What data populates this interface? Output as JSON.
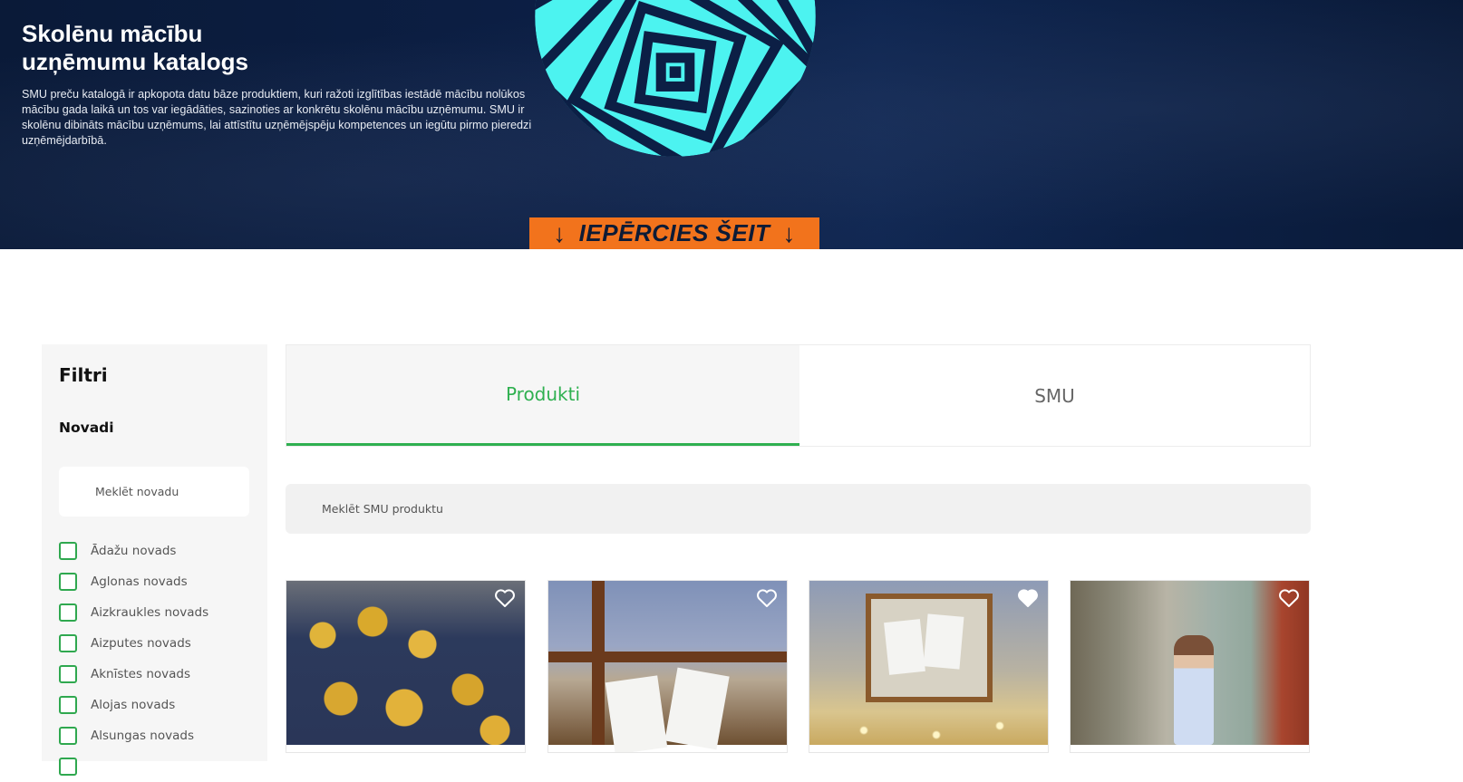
{
  "hero": {
    "title": "Skolēnu mācību uzņēmumu katalogs",
    "description": "SMU preču katalogā ir apkopota datu bāze produktiem, kuri ražoti izglītības iestādē mācību nolūkos mācību gada laikā un tos var iegādāties, sazinoties ar konkrētu skolēnu mācību uzņēmumu. SMU ir skolēnu dibināts mācību uzņēmums, lai attīstītu uzņēmējspēju kompetences un iegūtu pirmo pieredzi uzņēmējdarbībā.",
    "shop_button": "IEPĒRCIES ŠEIT",
    "accent_color": "#f2731c",
    "logo_color": "#4cf3f0"
  },
  "sidebar": {
    "title": "Filtri",
    "section_title": "Novadi",
    "search_placeholder": "Meklēt novadu",
    "items": [
      {
        "label": "Ādažu novads",
        "checked": false
      },
      {
        "label": "Aglonas novads",
        "checked": false
      },
      {
        "label": "Aizkraukles novads",
        "checked": false
      },
      {
        "label": "Aizputes novads",
        "checked": false
      },
      {
        "label": "Aknīstes novads",
        "checked": false
      },
      {
        "label": "Alojas novads",
        "checked": false
      },
      {
        "label": "Alsungas novads",
        "checked": false
      }
    ]
  },
  "tabs": [
    {
      "label": "Produkti",
      "active": true
    },
    {
      "label": "SMU",
      "active": false
    }
  ],
  "product_search": {
    "placeholder": "Meklēt SMU produktu"
  },
  "products": [
    {
      "image": "beeswax-candles",
      "favorited": false
    },
    {
      "image": "framed-line-drawings",
      "favorited": false
    },
    {
      "image": "framed-drawings-with-lights",
      "favorited": true
    },
    {
      "image": "person-in-old-town-street",
      "favorited": false
    }
  ],
  "colors": {
    "green": "#2fb050",
    "hero_bg": "#0c1f45"
  }
}
